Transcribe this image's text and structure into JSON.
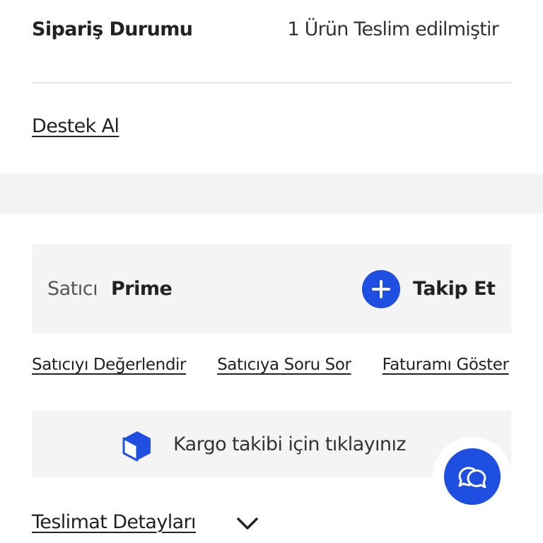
{
  "order_status": {
    "label": "Sipariş Durumu",
    "value": "1 Ürün Teslim edilmiştir"
  },
  "support": {
    "label": "Destek Al"
  },
  "seller": {
    "prefix": "Satıcı",
    "name": "Prime",
    "follow_label": "Takip Et",
    "follow_icon": "plus-icon"
  },
  "actions": [
    {
      "label": "Satıcıyı Değerlendir"
    },
    {
      "label": "Satıcıya Soru Sor"
    },
    {
      "label": "Faturamı Göster"
    }
  ],
  "cargo": {
    "label": "Kargo takibi için tıklayınız",
    "icon": "package-box-icon"
  },
  "chat": {
    "icon": "chat-bubbles-icon"
  },
  "delivery": {
    "label": "Teslimat Detayları",
    "icon": "chevron-down-icon"
  },
  "colors": {
    "accent": "#1f4fe0",
    "card_background": "#f4f4f4",
    "divider": "#e6e6e6",
    "text": "#222222"
  }
}
